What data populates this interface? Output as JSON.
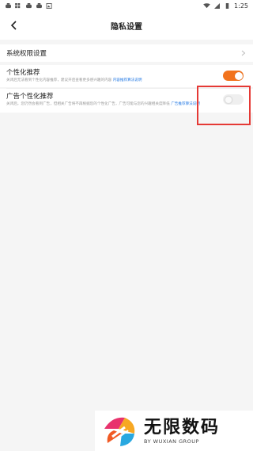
{
  "status_bar": {
    "left_icons": [
      "bug-icon",
      "grid-icon",
      "bug-icon",
      "bug-icon",
      "image-icon"
    ],
    "time": "1:25"
  },
  "nav": {
    "title": "隐私设置"
  },
  "system_permissions": {
    "label": "系统权限设置"
  },
  "personalized_recommend": {
    "title": "个性化推荐",
    "desc": "关闭后无法看到个性化内容推荐，建议开启查看更多感兴趣的内容",
    "link": "内容推荐算法说明",
    "enabled": true
  },
  "ad_personalization": {
    "title": "广告个性化推荐",
    "desc": "关闭后，您仍然会看到广告，但相关广告将不再根据您的个性化广告，广告可能与您的兴趣相关度降低",
    "link": "广告推荐算法说明",
    "enabled": false
  },
  "watermark": {
    "title": "无限数码",
    "subtitle": "BY WUXIAN GROUP"
  },
  "colors": {
    "accent": "#f2731d",
    "link": "#2b7ee5",
    "highlight": "#e53935"
  }
}
